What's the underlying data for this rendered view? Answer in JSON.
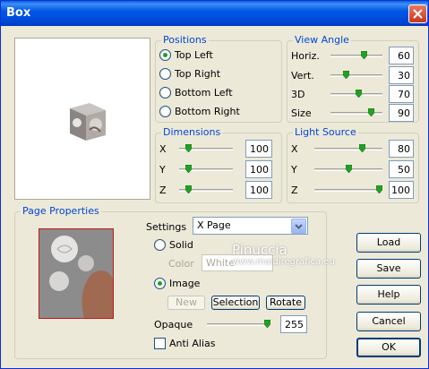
{
  "window": {
    "title": "Box",
    "close_icon": "close-icon"
  },
  "positions": {
    "legend": "Positions",
    "options": [
      {
        "label": "Top Left",
        "selected": true
      },
      {
        "label": "Top Right",
        "selected": false
      },
      {
        "label": "Bottom Left",
        "selected": false
      },
      {
        "label": "Bottom Right",
        "selected": false
      }
    ]
  },
  "view_angle": {
    "legend": "View Angle",
    "rows": [
      {
        "label": "Horiz.",
        "value": "60"
      },
      {
        "label": "Vert.",
        "value": "30"
      },
      {
        "label": "3D",
        "value": "70"
      },
      {
        "label": "Size",
        "value": "90"
      }
    ]
  },
  "dimensions": {
    "legend": "Dimensions",
    "rows": [
      {
        "label": "X",
        "value": "100"
      },
      {
        "label": "Y",
        "value": "100"
      },
      {
        "label": "Z",
        "value": "100"
      }
    ]
  },
  "light_source": {
    "legend": "Light Source",
    "rows": [
      {
        "label": "X",
        "value": "80"
      },
      {
        "label": "Y",
        "value": "50"
      },
      {
        "label": "Z",
        "value": "100"
      }
    ]
  },
  "page_properties": {
    "legend": "Page Properties",
    "settings_label": "Settings",
    "settings_value": "X Page",
    "solid_label": "Solid",
    "solid_selected": false,
    "color_label": "Color",
    "color_value": "White",
    "image_label": "Image",
    "image_selected": true,
    "new_label": "New",
    "selection_label": "Selection",
    "rotate_label": "Rotate",
    "opaque_label": "Opaque",
    "opaque_value": "255",
    "antialias_label": "Anti Alias",
    "antialias_checked": false
  },
  "watermark": {
    "name": "Pinuccia",
    "url": "www.maidiregrafica.eu"
  },
  "buttons": {
    "load": "Load",
    "save": "Save",
    "help": "Help",
    "cancel": "Cancel",
    "ok": "OK"
  },
  "colors": {
    "title_bar": "#0054e3",
    "legend_text": "#0046d5",
    "window_bg": "#ece9d8",
    "radio_dot": "#21a121"
  }
}
